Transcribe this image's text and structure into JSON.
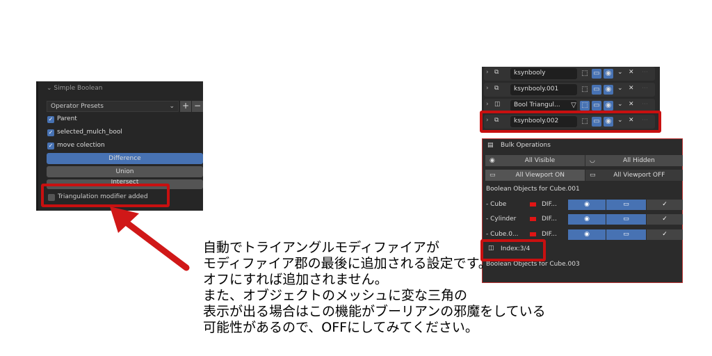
{
  "left_panel": {
    "title": "Simple Boolean",
    "preset": "Operator Presets",
    "add": "+",
    "remove": "−",
    "checkboxes": [
      {
        "label": "Parent",
        "checked": true
      },
      {
        "label": "selected_mulch_bool",
        "checked": true
      },
      {
        "label": "move colection",
        "checked": true
      }
    ],
    "buttons": [
      "Difference",
      "Union",
      "Intersect"
    ],
    "triangulation": {
      "label": "Triangulation modifier added",
      "checked": false
    }
  },
  "modifiers": [
    {
      "name": "ksynbooly"
    },
    {
      "name": "ksynbooly.001"
    },
    {
      "name": "Bool Triangul..."
    },
    {
      "name": "ksynbooly.002"
    }
  ],
  "bulk": {
    "title": "Bulk Operations",
    "all_visible": "All Visible",
    "all_hidden": "All Hidden",
    "all_viewport_on": "All Viewport ON",
    "all_viewport_off": "All Viewport OFF",
    "section1": "Boolean Objects for Cube.001",
    "objects": [
      {
        "name": "- Cube",
        "op": "DIF..."
      },
      {
        "name": "- Cylinder",
        "op": "DIF..."
      },
      {
        "name": "- Cube.0...",
        "op": "DIF..."
      }
    ],
    "index": "Index:3/4",
    "section2": "Boolean Objects for Cube.003"
  },
  "note": {
    "lines": [
      "自動でトライアングルモディファイアが",
      "モディファイア郡の最後に追加される設定です。",
      "オフにすれば追加されません。",
      "また、オブジェクトのメッシュに変な三角の",
      "表示が出る場合はこの機能がブーリアンの邪魔をしている",
      "可能性があるので、OFFにしてみてください。"
    ]
  },
  "colors": {
    "accent": "#4772b3",
    "highlight": "#c81010"
  }
}
